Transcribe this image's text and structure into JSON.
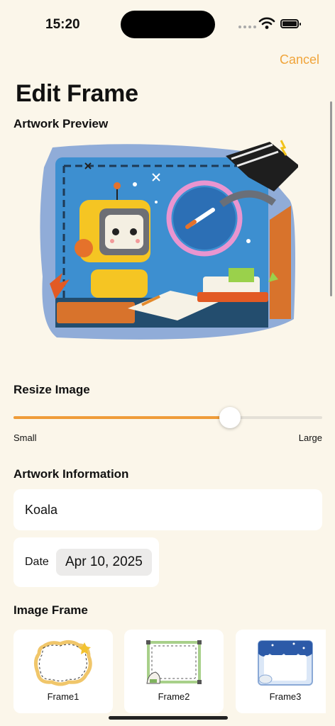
{
  "status_bar": {
    "time": "15:20"
  },
  "nav": {
    "cancel_label": "Cancel",
    "title": "Edit Frame"
  },
  "preview": {
    "heading": "Artwork Preview"
  },
  "resize": {
    "heading": "Resize Image",
    "min_label": "Small",
    "max_label": "Large",
    "value": 0.7
  },
  "info": {
    "heading": "Artwork Information",
    "name_value": "Koala",
    "date_label": "Date",
    "date_value": "Apr 10, 2025"
  },
  "frames": {
    "heading": "Image Frame",
    "items": [
      {
        "label": "Frame1"
      },
      {
        "label": "Frame2"
      },
      {
        "label": "Frame3"
      }
    ]
  },
  "colors": {
    "accent": "#f0a43a",
    "slider_fill": "#ef9c39",
    "background": "#fbf6ea"
  }
}
